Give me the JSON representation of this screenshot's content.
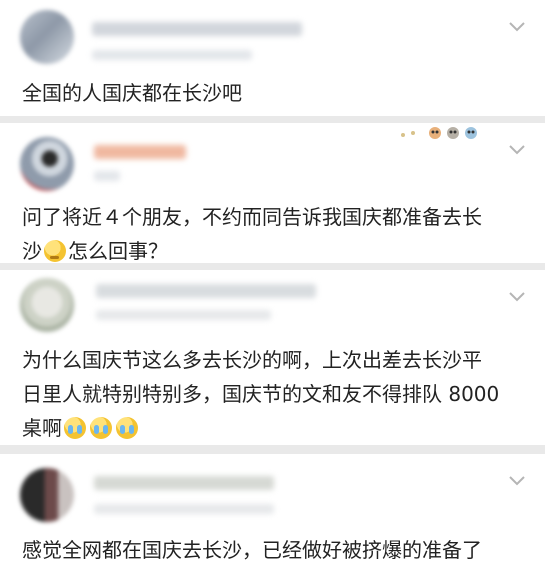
{
  "comments": [
    {
      "text": "全国的人国庆都在长沙吧"
    },
    {
      "text_line1": "问了将近４个朋友，不约而同告诉我国庆都准备去长",
      "text_line2_a": "沙",
      "text_line2_b": "怎么回事？",
      "emoji": "thinking-emoji"
    },
    {
      "text_line1": "为什么国庆节这么多去长沙的啊，上次出差去长沙平",
      "text_line2": "日里人就特别特别多，国庆节的文和友不得排队 8000",
      "text_line3": "桌啊",
      "emoji": "crying-emoji"
    },
    {
      "text": "感觉全网都在国庆去长沙，已经做好被挤爆的准备了"
    }
  ],
  "icons": {
    "chevron": "chevron-down-icon",
    "decoration": "owl-decoration-icon"
  }
}
